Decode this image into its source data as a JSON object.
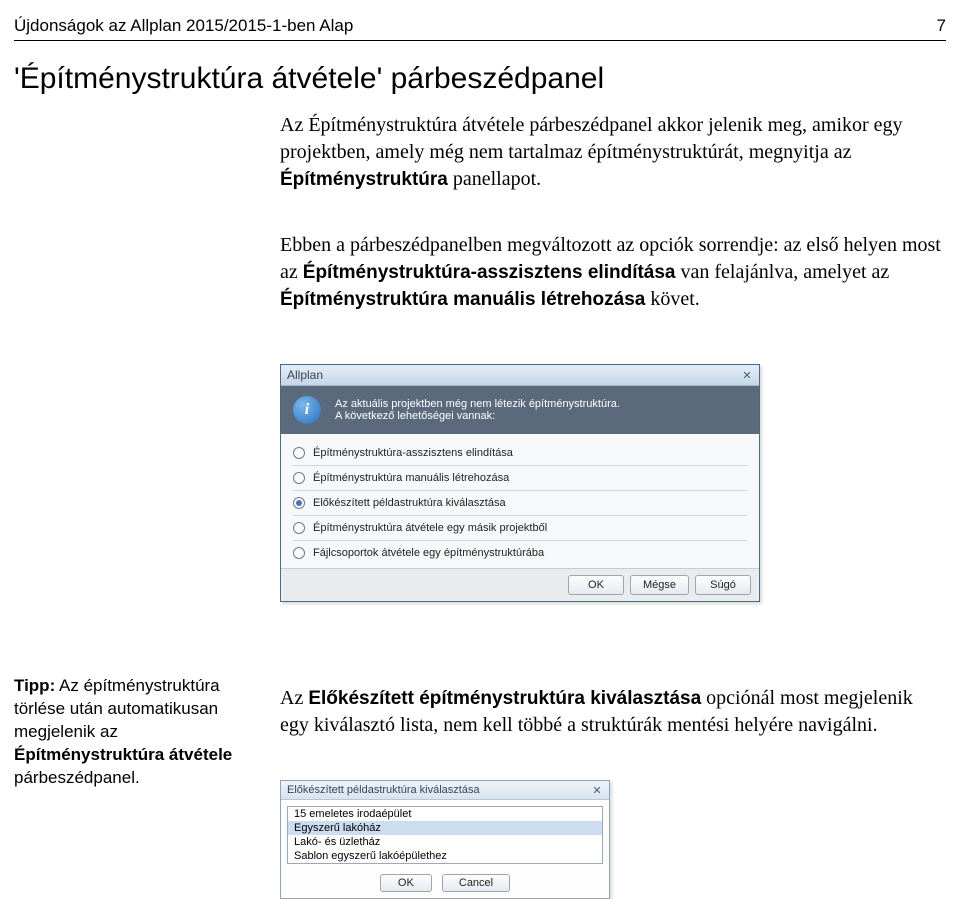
{
  "header": {
    "left": "Újdonságok az Allplan 2015/2015-1-ben   Alap",
    "right": "7"
  },
  "title": "'Építménystruktúra átvétele' párbeszédpanel",
  "para1_prefix": "Az Építménystruktúra átvétele párbeszédpanel akkor jelenik meg, amikor egy projektben, amely még nem tartalmaz építménystruktúrát, megnyitja az ",
  "para1_bold": "Építménystruktúra",
  "para1_suffix": " panellapot.",
  "para2_a": "Ebben a párbeszédpanelben megváltozott az opciók sorrendje: az első helyen most az ",
  "para2_b1": "Építménystruktúra-asszisztens elindítása",
  "para2_c": " van felajánlva, amelyet az ",
  "para2_b2": "Építménystruktúra manuális létrehozása",
  "para2_d": " követ.",
  "dialog1": {
    "title": "Allplan",
    "info_line1": "Az aktuális projektben még nem létezik építménystruktúra.",
    "info_line2": "A következő lehetőségei vannak:",
    "options": [
      "Építménystruktúra-asszisztens elindítása",
      "Építménystruktúra manuális létrehozása",
      "Előkészített példastruktúra kiválasztása",
      "Építménystruktúra átvétele egy másik projektből",
      "Fájlcsoportok átvétele egy építménystruktúrába"
    ],
    "selected_index": 2,
    "buttons": {
      "ok": "OK",
      "cancel": "Mégse",
      "help": "Súgó"
    }
  },
  "tip": {
    "prefix": "Tipp:",
    "text_a": " Az építménystruktúra törlése után automatikusan megjelenik az ",
    "bold": "Építménystruktúra átvétele",
    "text_b": " párbeszédpanel."
  },
  "para3_a": "Az ",
  "para3_b": "Előkészített építménystruktúra kiválasztása",
  "para3_c": " opciónál most megjelenik egy kiválasztó lista, nem kell többé a struktúrák mentési helyére navigálni.",
  "dialog2": {
    "title": "Előkészített példastruktúra kiválasztása",
    "items": [
      "15 emeletes irodaépület",
      "Egyszerű lakóház",
      "Lakó- és üzletház",
      "Sablon egyszerű lakóépülethez"
    ],
    "selected_index": 1,
    "buttons": {
      "ok": "OK",
      "cancel": "Cancel"
    }
  }
}
